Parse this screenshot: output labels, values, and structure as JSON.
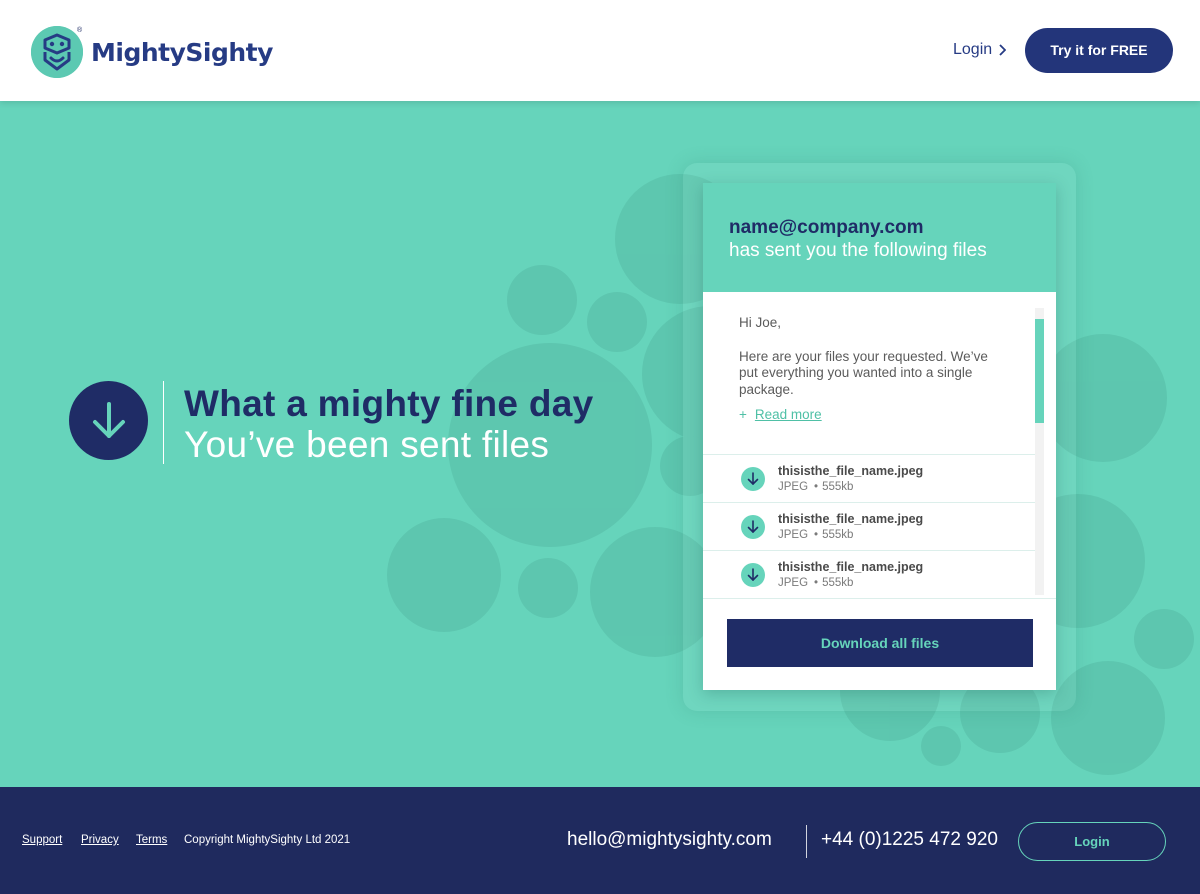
{
  "header": {
    "brand": "MightySighty",
    "brand_mark": "®",
    "nav_login_label": "Login",
    "cta_label": "Try it for FREE"
  },
  "hero": {
    "title": "What a mighty fine day",
    "subtitle": "You’ve been sent files",
    "icon": "download-arrow-icon"
  },
  "card": {
    "sender": "name@company.com",
    "sent_text": "has sent you the following files",
    "greeting": "Hi Joe,",
    "message": "Here are your files your requested. We’ve put everything you wanted into a single package.",
    "read_more_prefix": "+",
    "read_more_label": "Read more",
    "files": [
      {
        "name": "thisisthe_file_name.jpeg",
        "type": "JPEG",
        "size": "555kb"
      },
      {
        "name": "thisisthe_file_name.jpeg",
        "type": "JPEG",
        "size": "555kb"
      },
      {
        "name": "thisisthe_file_name.jpeg",
        "type": "JPEG",
        "size": "555kb"
      }
    ],
    "download_all_label": "Download all files"
  },
  "footer": {
    "links": [
      "Support",
      "Privacy",
      "Terms"
    ],
    "copyright": "Copyright MightySighty Ltd 2021",
    "email": "hello@mightysighty.com",
    "phone": "+44 (0)1225 472 920",
    "login_label": "Login"
  },
  "colors": {
    "brand_navy": "#1f2c66",
    "brand_teal": "#66d4bb",
    "white": "#ffffff"
  }
}
